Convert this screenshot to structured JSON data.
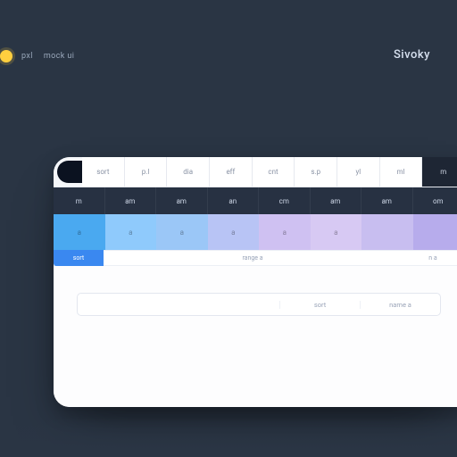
{
  "header": {
    "badge_label_1": "pxl",
    "badge_label_2": "mock ui",
    "brand": "Sivoky"
  },
  "tabs": [
    "sort",
    "p.l",
    "dia",
    "eff",
    "cnt",
    "s.p",
    "yl",
    "ml"
  ],
  "tab_dark": "m",
  "hdr": [
    "m",
    "am",
    "am",
    "an",
    "cm",
    "am",
    "am",
    "om"
  ],
  "swatches": [
    "a",
    "a",
    "a",
    "a",
    "a",
    "a",
    "",
    ""
  ],
  "strip": {
    "left": "sort",
    "mid": "range a",
    "right": "n a"
  },
  "search": {
    "field": "",
    "col1": "sort",
    "col2": "name a"
  }
}
